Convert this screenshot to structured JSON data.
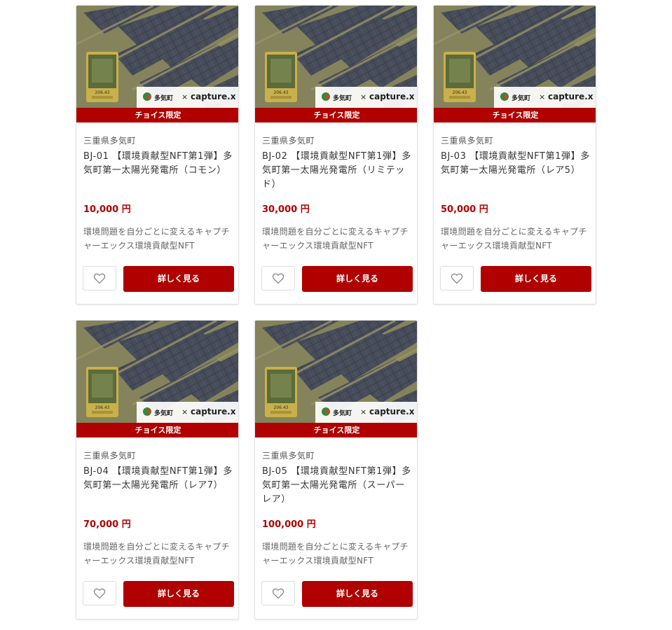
{
  "products": [
    {
      "image": {
        "alt": "solar-farm-aerial-photo",
        "card_value": "206.43",
        "town_logo": "多気町",
        "partner_logo": "capture.x",
        "cross": "×"
      },
      "badge": "チョイス限定",
      "region": "三重県多気町",
      "title": "BJ-01 【環境貢献型NFT第1弾】多気町第一太陽光発電所（コモン）",
      "price": "10,000 円",
      "description": "環境問題を自分ごとに変えるキャプチャーエックス環境貢献型NFT",
      "favorite_icon": "heart-icon",
      "detail_label": "詳しく見る"
    },
    {
      "image": {
        "alt": "solar-farm-aerial-photo",
        "card_value": "206.43",
        "town_logo": "多気町",
        "partner_logo": "capture.x",
        "cross": "×"
      },
      "badge": "チョイス限定",
      "region": "三重県多気町",
      "title": "BJ-02 【環境貢献型NFT第1弾】多気町第一太陽光発電所（リミテッド）",
      "price": "30,000 円",
      "description": "環境問題を自分ごとに変えるキャプチャーエックス環境貢献型NFT",
      "favorite_icon": "heart-icon",
      "detail_label": "詳しく見る"
    },
    {
      "image": {
        "alt": "solar-farm-aerial-photo",
        "card_value": "206.43",
        "town_logo": "多気町",
        "partner_logo": "capture.x",
        "cross": "×"
      },
      "badge": "チョイス限定",
      "region": "三重県多気町",
      "title": "BJ-03 【環境貢献型NFT第1弾】多気町第一太陽光発電所（レア5）",
      "price": "50,000 円",
      "description": "環境問題を自分ごとに変えるキャプチャーエックス環境貢献型NFT",
      "favorite_icon": "heart-icon",
      "detail_label": "詳しく見る"
    },
    {
      "image": {
        "alt": "solar-farm-aerial-photo",
        "card_value": "206.43",
        "town_logo": "多気町",
        "partner_logo": "capture.x",
        "cross": "×"
      },
      "badge": "チョイス限定",
      "region": "三重県多気町",
      "title": "BJ-04 【環境貢献型NFT第1弾】多気町第一太陽光発電所（レア7）",
      "price": "70,000 円",
      "description": "環境問題を自分ごとに変えるキャプチャーエックス環境貢献型NFT",
      "favorite_icon": "heart-icon",
      "detail_label": "詳しく見る"
    },
    {
      "image": {
        "alt": "solar-farm-aerial-photo",
        "card_value": "206.43",
        "town_logo": "多気町",
        "partner_logo": "capture.x",
        "cross": "×"
      },
      "badge": "チョイス限定",
      "region": "三重県多気町",
      "title": "BJ-05 【環境貢献型NFT第1弾】多気町第一太陽光発電所（スーパーレア）",
      "price": "100,000 円",
      "description": "環境問題を自分ごとに変えるキャプチャーエックス環境貢献型NFT",
      "favorite_icon": "heart-icon",
      "detail_label": "詳しく見る"
    }
  ],
  "colors": {
    "accent": "#b00000",
    "region_text": "#555555",
    "title_text": "#333333",
    "description_text": "#666666",
    "card_border": "#e3e3e3",
    "heart_stroke": "#888888"
  }
}
